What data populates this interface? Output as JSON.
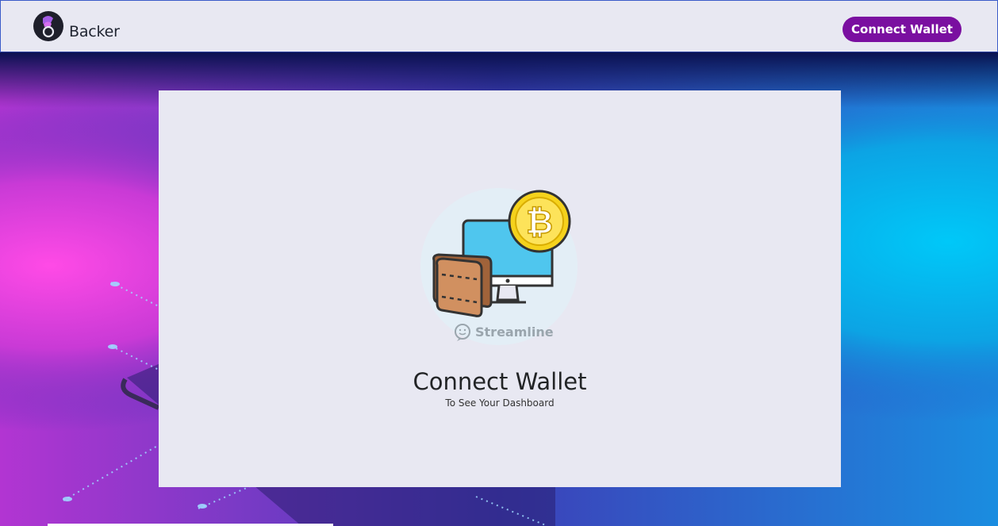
{
  "header": {
    "brand": "Backer",
    "connect_button_label": "Connect Wallet",
    "logo_icon": "backer-logo-icon"
  },
  "card": {
    "title": "Connect Wallet",
    "subtitle": "To See Your Dashboard",
    "illustration_icon": "wallet-computer-bitcoin-icon",
    "illustration_caption": "Streamline"
  },
  "colors": {
    "header_bg": "#e8e8f2",
    "button_bg": "#7a0fa0",
    "card_bg": "#e8e8f2",
    "bg_magenta": "#e046e0",
    "bg_cyan": "#00bff2",
    "bg_navy": "#0d1450"
  }
}
